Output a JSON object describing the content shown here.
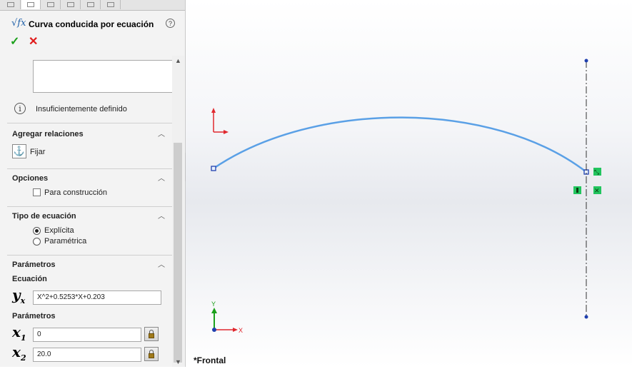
{
  "property_manager": {
    "title": "Curva conducida por ecuación",
    "title_icon": "equation-curve-icon",
    "help_icon": "help-icon",
    "status_text": "Insuficientemente definido",
    "sections": {
      "relations": {
        "title": "Agregar relaciones",
        "fix_label": "Fijar"
      },
      "options": {
        "title": "Opciones",
        "construction_label": "Para construcción",
        "construction_checked": false
      },
      "equation_type": {
        "title": "Tipo de ecuación",
        "options": [
          "Explícita",
          "Paramétrica"
        ],
        "selected": "Explícita"
      },
      "parameters": {
        "title": "Parámetros",
        "equation_label": "Ecuación",
        "equation_var": "y",
        "equation_var_sub": "x",
        "equation_value": "X^2+0.5253*X+0.203",
        "params_label": "Parámetros",
        "x1_var": "x",
        "x1_sub": "1",
        "x1_value": "0",
        "x2_var": "x",
        "x2_sub": "2",
        "x2_value": "20.0"
      }
    }
  },
  "viewport": {
    "view_name": "*Frontal",
    "triad": {
      "x_label": "X",
      "y_label": "Y"
    },
    "colors": {
      "curve": "#5aa0e6",
      "endpoint": "#1f3fae",
      "centerline": "#333333",
      "relation_badge": "#22c55e",
      "triad_x": "#e0282e",
      "triad_y": "#1ba01b",
      "origin": "#e0282e"
    }
  }
}
